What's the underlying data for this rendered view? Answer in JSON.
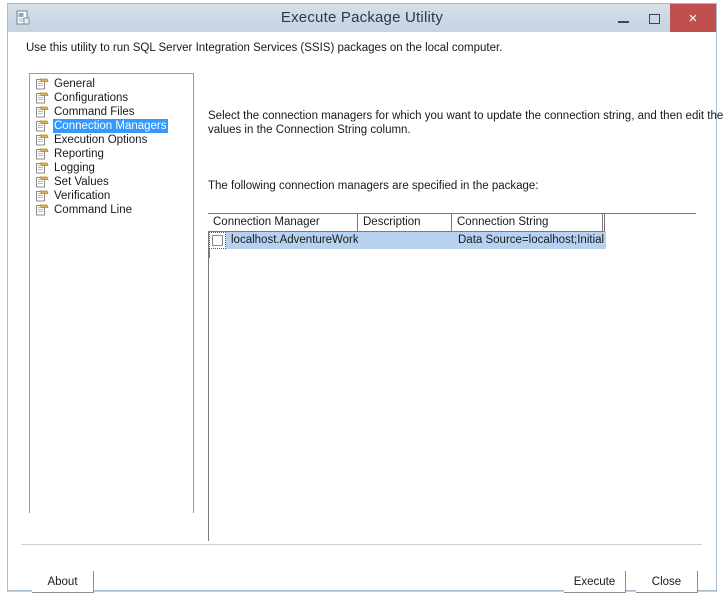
{
  "window": {
    "title": "Execute Package Utility",
    "icon": "package-utility-icon",
    "controls": {
      "minimize": "minimize-icon",
      "maximize": "maximize-icon",
      "close": "×"
    }
  },
  "intro": "Use this utility to run SQL Server Integration Services (SSIS) packages on the local computer.",
  "tree": {
    "items": [
      {
        "label": "General",
        "selected": false
      },
      {
        "label": "Configurations",
        "selected": false
      },
      {
        "label": "Command Files",
        "selected": false
      },
      {
        "label": "Connection Managers",
        "selected": true
      },
      {
        "label": "Execution Options",
        "selected": false
      },
      {
        "label": "Reporting",
        "selected": false
      },
      {
        "label": "Logging",
        "selected": false
      },
      {
        "label": "Set Values",
        "selected": false
      },
      {
        "label": "Verification",
        "selected": false
      },
      {
        "label": "Command Line",
        "selected": false
      }
    ],
    "selection_color": "#3399ff"
  },
  "pane": {
    "description_line1": "Select the connection managers for which you want to update the connection string, and then edit the",
    "description_line2": "values in the Connection String column.",
    "list_intro": "The following connection managers are specified in the package:"
  },
  "grid": {
    "columns": [
      "Connection Manager",
      "Description",
      "Connection String",
      ""
    ],
    "rows": [
      {
        "checked": false,
        "connection_manager": "localhost.AdventureWork...",
        "description": "",
        "connection_string": "Data Source=localhost;Initial...",
        "selected": true
      }
    ],
    "row_highlight_color": "#b6d2f0"
  },
  "footer": {
    "about_label": "About",
    "execute_label": "Execute",
    "close_label": "Close"
  }
}
